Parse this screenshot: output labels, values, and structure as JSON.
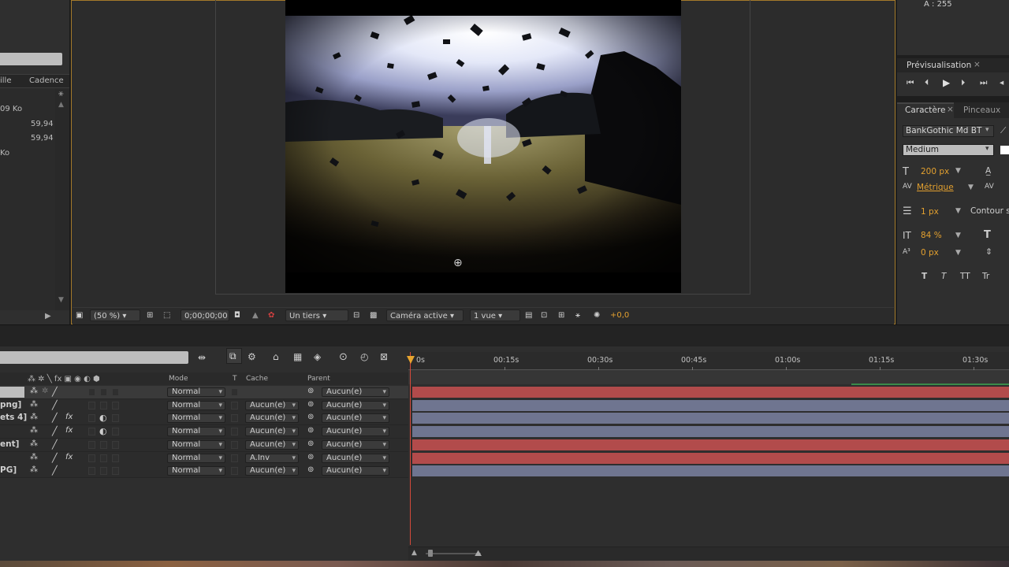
{
  "project_panel": {
    "columns": [
      "ille",
      "Cadence"
    ],
    "rows": [
      {
        "size": "09 Ko",
        "cadence": ""
      },
      {
        "size": "",
        "cadence": "59,94"
      },
      {
        "size": "",
        "cadence": "59,94"
      },
      {
        "size": "Ko",
        "cadence": ""
      }
    ]
  },
  "viewer": {
    "zoom": "(50 %)",
    "timecode": "0;00;00;00",
    "resolution": "Un tiers",
    "camera": "Caméra active",
    "views": "1 vue",
    "exposure": "+0,0"
  },
  "info_panel": {
    "alpha": "A : 255"
  },
  "preview_panel": {
    "tab": "Prévisualisation",
    "close": "×"
  },
  "character_panel": {
    "tabs": [
      "Caractère",
      "Pinceaux"
    ],
    "close": "×",
    "font_family": "BankGothic Md BT",
    "font_style": "Medium",
    "font_size": "200 px",
    "kerning": "Métrique",
    "stroke_width": "1 px",
    "stroke_type": "Contour s",
    "vertical_scale": "84 %",
    "baseline_shift": "0 px",
    "style_buttons": [
      "T",
      "T",
      "TT",
      "Tr"
    ]
  },
  "timeline": {
    "columns": {
      "mode": "Mode",
      "t": "T",
      "cache": "Cache",
      "parent": "Parent"
    },
    "layers": [
      {
        "name": "",
        "mode": "Normal",
        "cache": "",
        "parent": "Aucun(e)",
        "fx": false,
        "bar": "red"
      },
      {
        "name": "png]",
        "mode": "Normal",
        "cache": "Aucun(e)",
        "parent": "Aucun(e)",
        "fx": false,
        "bar": "blue"
      },
      {
        "name": "ets 4]",
        "mode": "Normal",
        "cache": "Aucun(e)",
        "parent": "Aucun(e)",
        "fx": true,
        "bar": "blue"
      },
      {
        "name": "",
        "mode": "Normal",
        "cache": "Aucun(e)",
        "parent": "Aucun(e)",
        "fx": true,
        "bar": "blue"
      },
      {
        "name": "ent]",
        "mode": "Normal",
        "cache": "Aucun(e)",
        "parent": "Aucun(e)",
        "fx": false,
        "bar": "red"
      },
      {
        "name": "",
        "mode": "Normal",
        "cache": "A.Inv",
        "parent": "Aucun(e)",
        "fx": true,
        "bar": "red"
      },
      {
        "name": "PG]",
        "mode": "Normal",
        "cache": "Aucun(e)",
        "parent": "Aucun(e)",
        "fx": false,
        "bar": "blue"
      }
    ],
    "ruler_ticks": [
      "0s",
      "00:15s",
      "00:30s",
      "00:45s",
      "01:00s",
      "01:15s",
      "01:30s"
    ]
  }
}
